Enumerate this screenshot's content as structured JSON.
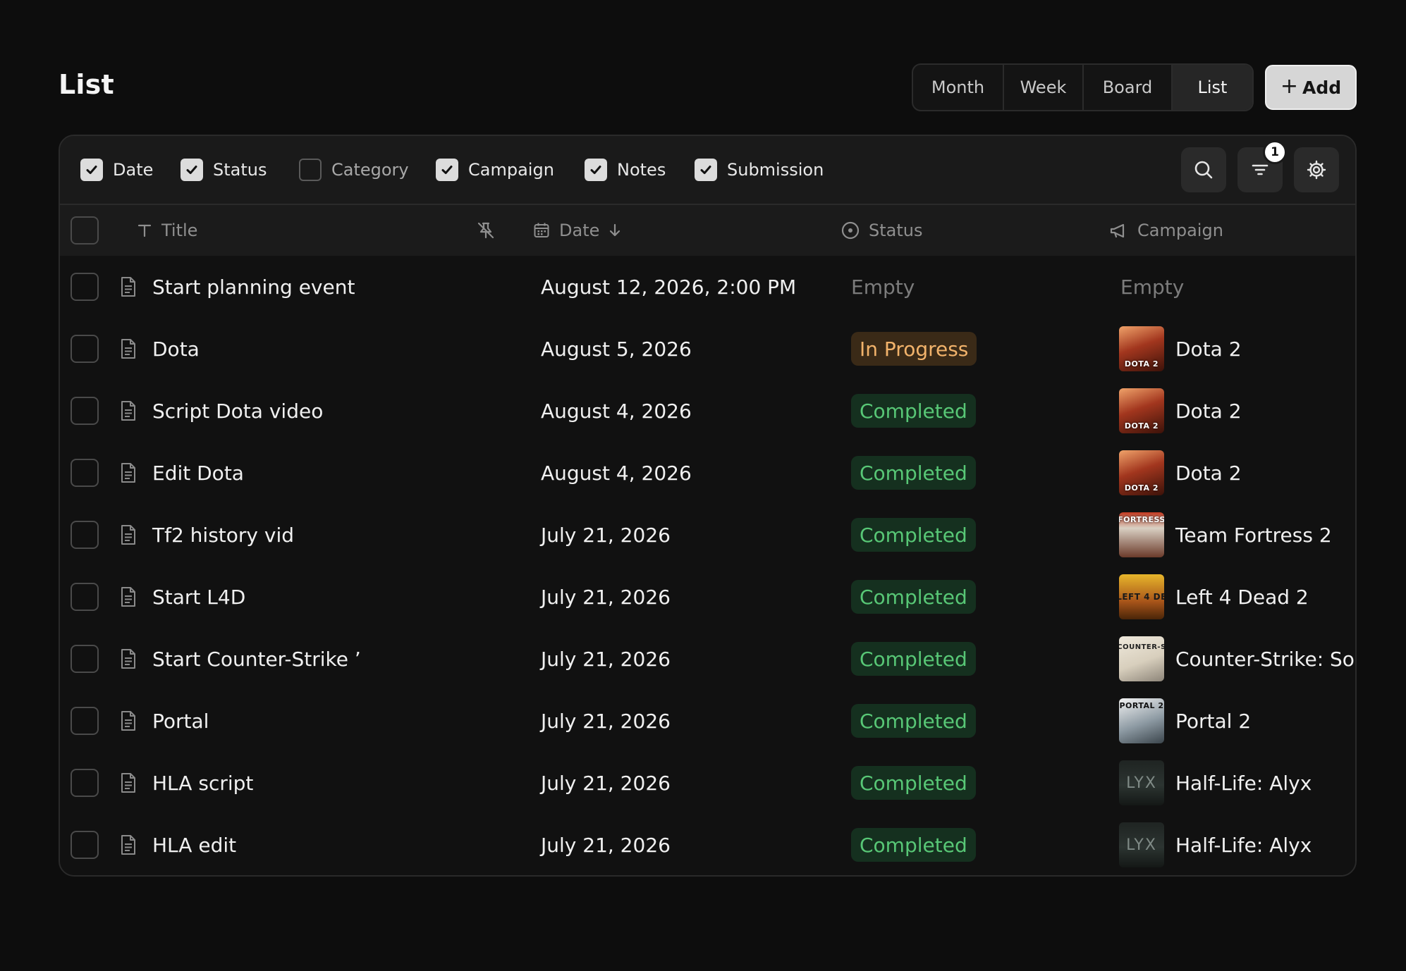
{
  "page": {
    "title": "List"
  },
  "views": {
    "tabs": [
      "Month",
      "Week",
      "Board",
      "List"
    ],
    "active": "List"
  },
  "add_button": {
    "label": "Add"
  },
  "column_toggles": [
    {
      "label": "Date",
      "checked": true
    },
    {
      "label": "Status",
      "checked": true
    },
    {
      "label": "Category",
      "checked": false
    },
    {
      "label": "Campaign",
      "checked": true
    },
    {
      "label": "Notes",
      "checked": true
    },
    {
      "label": "Submission",
      "checked": true
    }
  ],
  "toolbar": {
    "filter_badge": "1"
  },
  "table": {
    "headers": {
      "title": "Title",
      "date": "Date",
      "status": "Status",
      "campaign": "Campaign"
    },
    "sort": {
      "column": "Date",
      "direction": "descending"
    },
    "rows": [
      {
        "title": "Start planning event",
        "date": "August 12, 2026, 2:00 PM",
        "status": "Empty",
        "campaign": "Empty"
      },
      {
        "title": "Dota",
        "date": "August 5, 2026",
        "status": "In Progress",
        "campaign": "Dota 2"
      },
      {
        "title": "Script Dota video",
        "date": "August 4, 2026",
        "status": "Completed",
        "campaign": "Dota 2"
      },
      {
        "title": "Edit Dota",
        "date": "August 4, 2026",
        "status": "Completed",
        "campaign": "Dota 2"
      },
      {
        "title": "Tf2 history vid",
        "date": "July 21, 2026",
        "status": "Completed",
        "campaign": "Team Fortress 2"
      },
      {
        "title": "Start L4D",
        "date": "July 21, 2026",
        "status": "Completed",
        "campaign": "Left 4 Dead 2"
      },
      {
        "title": "Start Counter-Strike ’",
        "date": "July 21, 2026",
        "status": "Completed",
        "campaign": "Counter-Strike: Sou"
      },
      {
        "title": "Portal",
        "date": "July 21, 2026",
        "status": "Completed",
        "campaign": "Portal 2"
      },
      {
        "title": "HLA script",
        "date": "July 21, 2026",
        "status": "Completed",
        "campaign": "Half-Life: Alyx"
      },
      {
        "title": "HLA edit",
        "date": "July 21, 2026",
        "status": "Completed",
        "campaign": "Half-Life: Alyx"
      }
    ]
  },
  "thumbnail_text": {
    "dota": "DOTA 2",
    "tf2": "FORTRESS",
    "l4d": "LEFT 4 DE",
    "cs": "COUNTER-S",
    "portal": "PORTAL 2",
    "hla": "LYX"
  },
  "colors": {
    "in_progress_bg": "#3a2a17",
    "in_progress_text": "#f2b36b",
    "completed_bg": "#15301f",
    "completed_text": "#58c776"
  }
}
